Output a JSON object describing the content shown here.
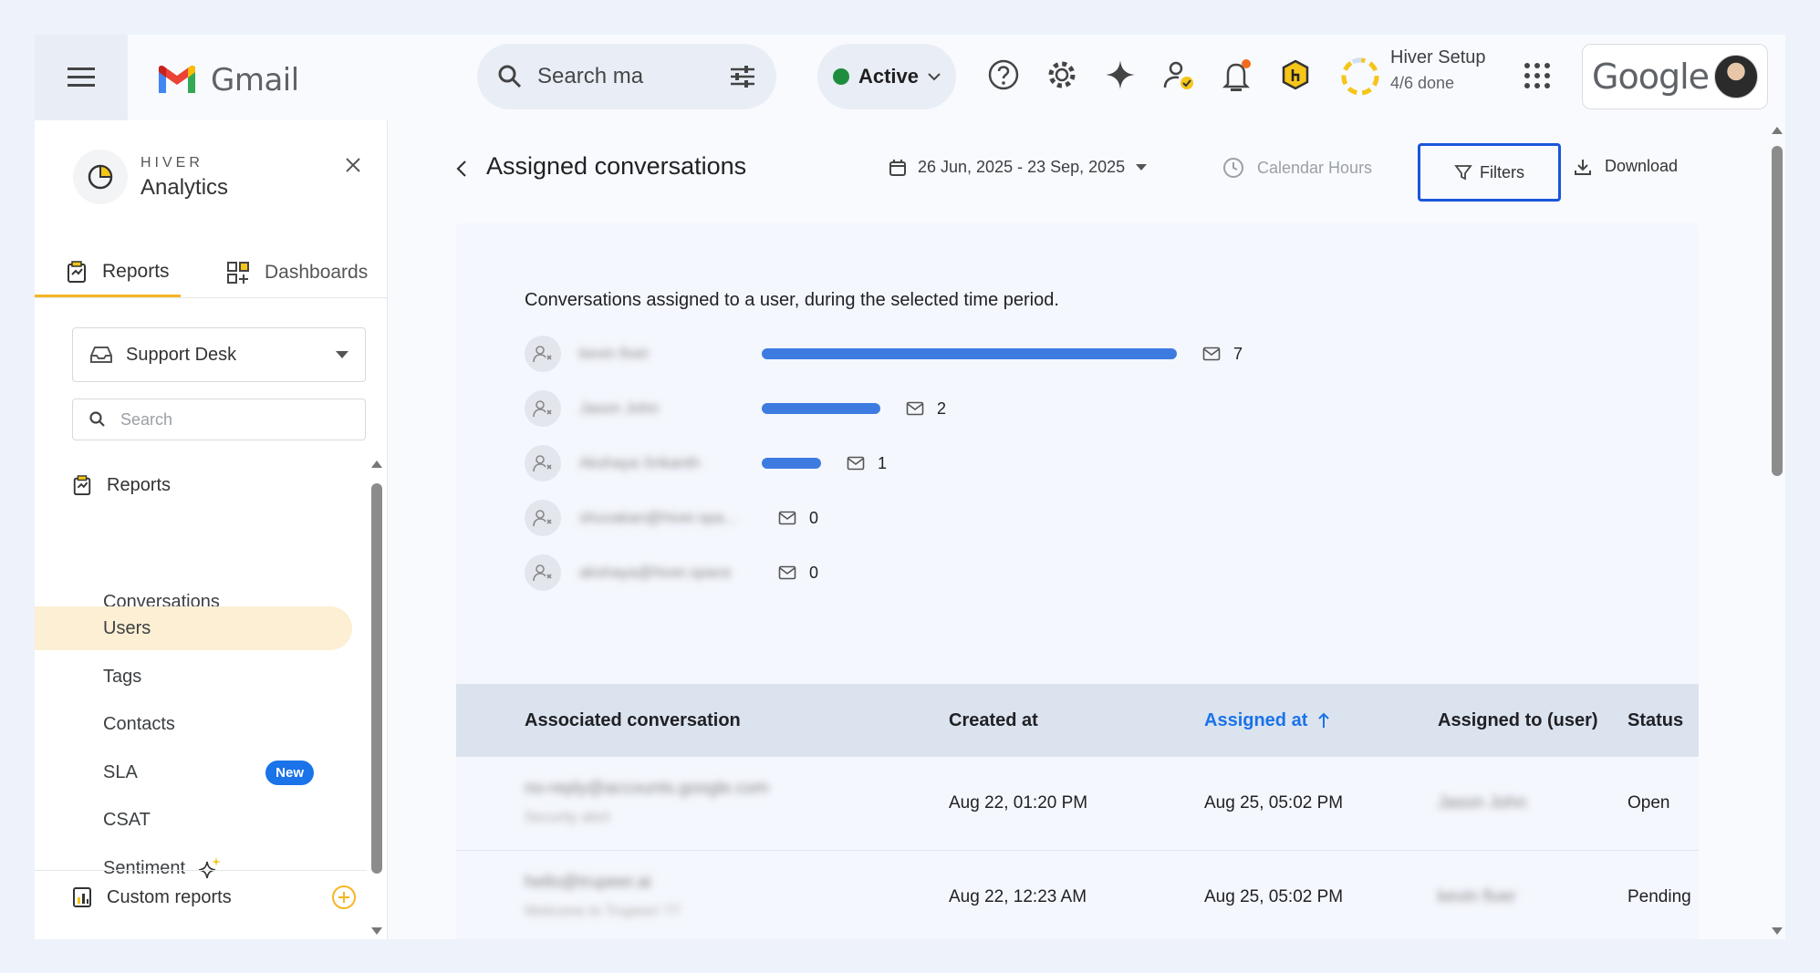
{
  "topbar": {
    "app_name": "Gmail",
    "search_placeholder": "Search ma",
    "status_label": "Active",
    "hiver_setup_title": "Hiver Setup",
    "hiver_setup_progress": "4/6 done",
    "google_label": "Google"
  },
  "sidebar": {
    "brand": "HIVER",
    "title": "Analytics",
    "tabs": [
      {
        "label": "Reports"
      },
      {
        "label": "Dashboards"
      }
    ],
    "inbox_select": "Support Desk",
    "search_placeholder": "Search",
    "section_label": "Reports",
    "items": [
      {
        "label": "Conversations"
      },
      {
        "label": "Users"
      },
      {
        "label": "Tags"
      },
      {
        "label": "Contacts"
      },
      {
        "label": "SLA",
        "badge": "New"
      },
      {
        "label": "CSAT"
      },
      {
        "label": "Sentiment"
      }
    ],
    "custom_reports": "Custom reports"
  },
  "header": {
    "title": "Assigned conversations",
    "date_range": "26 Jun, 2025 - 23 Sep, 2025",
    "calendar_hours": "Calendar Hours",
    "filters": "Filters",
    "download": "Download"
  },
  "report": {
    "description": "Conversations assigned to a user, during the selected time period.",
    "max_count": 7,
    "users": [
      {
        "name": "kevin fiver",
        "count": "7",
        "value": 7
      },
      {
        "name": "Jason John",
        "count": "2",
        "value": 2
      },
      {
        "name": "Akshaya Srikanth",
        "count": "1",
        "value": 1
      },
      {
        "name": "shuvakan@hiver.spa...",
        "count": "0",
        "value": 0
      },
      {
        "name": "akshaya@hiver.space",
        "count": "0",
        "value": 0
      }
    ]
  },
  "table": {
    "columns": [
      "Associated conversation",
      "Created at",
      "Assigned at",
      "Assigned to (user)",
      "Status"
    ],
    "rows": [
      {
        "from": "no-reply@accounts.google.com",
        "subject": "Security alert",
        "created": "Aug 22, 01:20 PM",
        "assigned": "Aug 25, 05:02 PM",
        "user": "Jason John",
        "status": "Open"
      },
      {
        "from": "hello@trupeer.ai",
        "subject": "Welcome to Trupeer! ??",
        "created": "Aug 22, 12:23 AM",
        "assigned": "Aug 25, 05:02 PM",
        "user": "kevin fiver",
        "status": "Pending"
      }
    ]
  },
  "colors": {
    "accent": "#1a73e8",
    "bar": "#3d7be0",
    "highlight": "#fdefd3",
    "tab_underline": "#f5b623"
  }
}
